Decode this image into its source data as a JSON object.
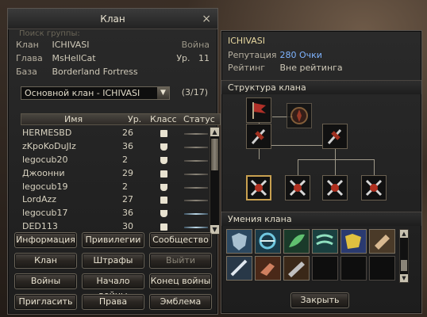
{
  "window": {
    "title": "Клан",
    "close_icon": "×"
  },
  "info": {
    "ghost_text": "Поиск группы:",
    "clan_label": "Клан",
    "clan_value": "ICHIVASI",
    "war_label": "Война",
    "leader_label": "Глава",
    "leader_value": "MsHellCat",
    "level_label": "Ур.",
    "level_value": "11",
    "base_label": "База",
    "base_value": "Borderland Fortress"
  },
  "selector": {
    "value": "Основной клан - ICHIVASI",
    "arrow": "▼",
    "count": "(3/17)"
  },
  "table": {
    "headers": {
      "name": "Имя",
      "level": "Ур.",
      "class": "Класс",
      "status": "Статус"
    },
    "rows": [
      {
        "name": "HERMESBD",
        "level": "26",
        "class_icon": "down-arrow-icon",
        "online": false
      },
      {
        "name": "zKpoKoDuJIz",
        "level": "36",
        "class_icon": "book-icon",
        "online": false
      },
      {
        "name": "legocub20",
        "level": "2",
        "class_icon": "book-icon",
        "online": false
      },
      {
        "name": "Джоонни",
        "level": "29",
        "class_icon": "down-arrow-icon",
        "online": false
      },
      {
        "name": "legocub19",
        "level": "2",
        "class_icon": "book-icon",
        "online": false
      },
      {
        "name": "LordAzz",
        "level": "27",
        "class_icon": "down-arrow-icon",
        "online": false
      },
      {
        "name": "legocub17",
        "level": "36",
        "class_icon": "book-icon",
        "online": true
      },
      {
        "name": "DED113",
        "level": "30",
        "class_icon": "down-arrow-icon",
        "online": true
      }
    ]
  },
  "buttons": {
    "info": "Информация",
    "privileges": "Привилегии",
    "community": "Сообщество",
    "clan": "Клан",
    "penalties": "Штрафы",
    "leave": "Выйти",
    "wars": "Войны",
    "start_war": "Начало войны",
    "end_war": "Конец войны",
    "invite": "Пригласить",
    "rights": "Права",
    "emblem": "Эмблема"
  },
  "right": {
    "clan_name": "ICHIVASI",
    "reputation_label": "Репутация",
    "reputation_value": "280 Очки",
    "rating_label": "Рейтинг",
    "rating_value": "Вне рейтинга",
    "structure_title": "Структура клана",
    "skills_title": "Умения клана",
    "close_button": "Закрыть"
  },
  "colors": {
    "accent_blue": "#7fb4ff",
    "gold_border": "#c8a050",
    "clan_name": "#e8d8a0"
  }
}
